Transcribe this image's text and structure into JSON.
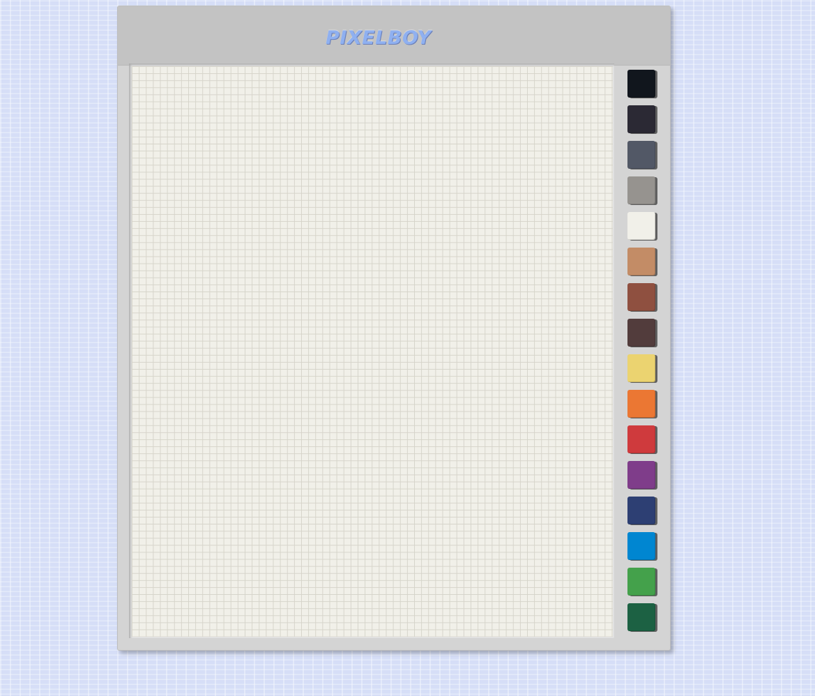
{
  "app": {
    "title": "PIXELBOY"
  },
  "colors": {
    "title_fill": "#8fb0f0",
    "canvas_background": "#f1f0e9",
    "grid_line": "#d6d4ca"
  },
  "palette": [
    {
      "name": "swatch-black",
      "color": "#11161d"
    },
    {
      "name": "swatch-dark-slate",
      "color": "#2b2934"
    },
    {
      "name": "swatch-slate-gray",
      "color": "#525866"
    },
    {
      "name": "swatch-warm-gray",
      "color": "#96938f"
    },
    {
      "name": "swatch-off-white",
      "color": "#f1f0e9"
    },
    {
      "name": "swatch-tan",
      "color": "#c38c66"
    },
    {
      "name": "swatch-rust-brown",
      "color": "#8f5040"
    },
    {
      "name": "swatch-dark-brown",
      "color": "#523c3c"
    },
    {
      "name": "swatch-yellow",
      "color": "#ebd370"
    },
    {
      "name": "swatch-orange",
      "color": "#eb7733"
    },
    {
      "name": "swatch-red",
      "color": "#cf3a3d"
    },
    {
      "name": "swatch-purple",
      "color": "#7f3d8a"
    },
    {
      "name": "swatch-navy",
      "color": "#2d3f73"
    },
    {
      "name": "swatch-blue",
      "color": "#0086d1"
    },
    {
      "name": "swatch-green",
      "color": "#44a14b"
    },
    {
      "name": "swatch-dark-green",
      "color": "#1c6143"
    }
  ]
}
